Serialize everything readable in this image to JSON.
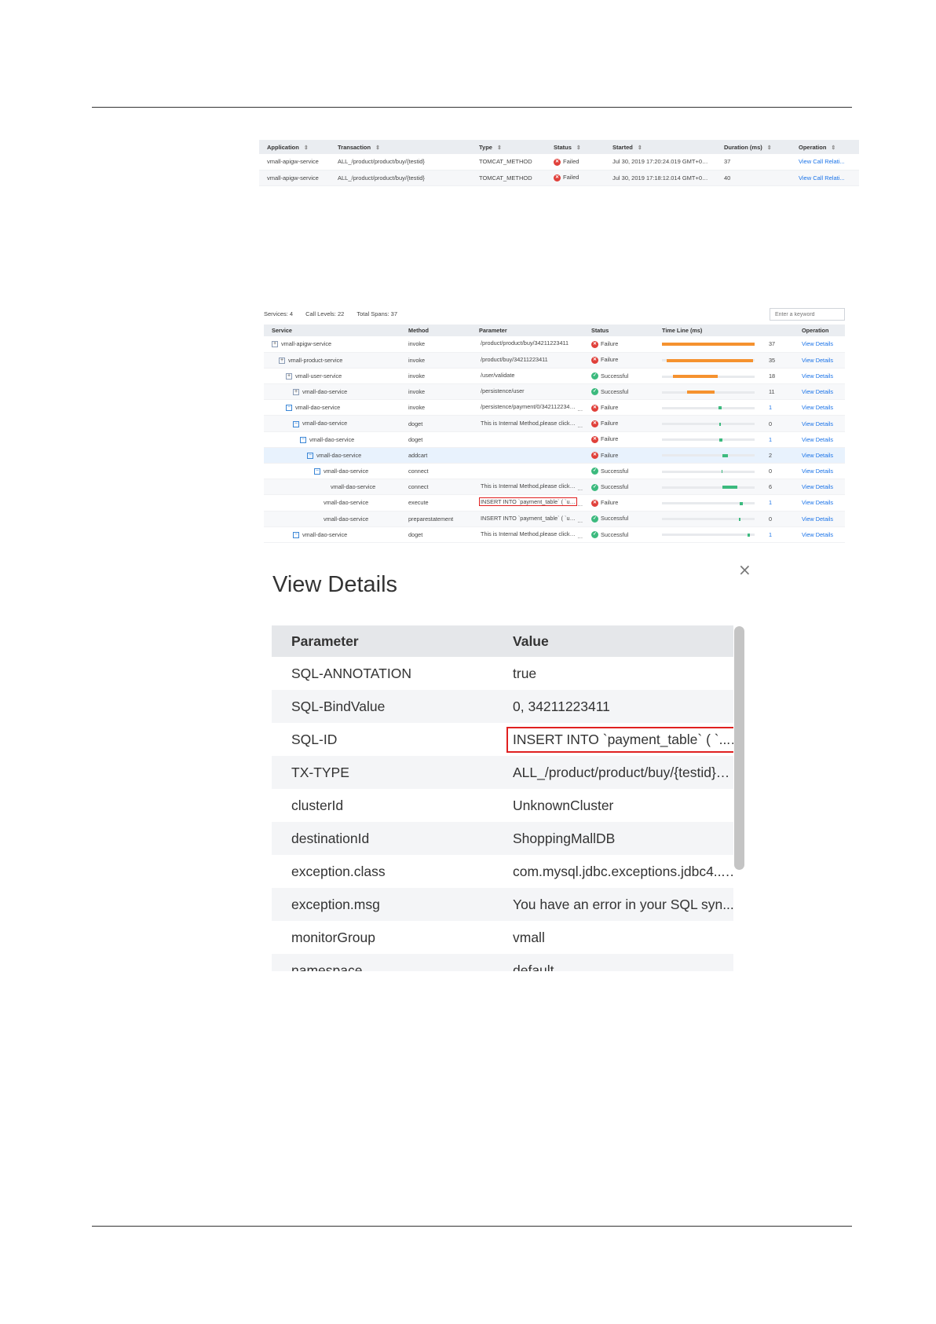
{
  "transactions": {
    "columns": [
      "Application",
      "Transaction",
      "Type",
      "Status",
      "Started",
      "Duration (ms)",
      "Operation"
    ],
    "rows": [
      {
        "application": "vmall-apigw-service",
        "transaction": "ALL_/product/product/buy/{testid}",
        "type": "TOMCAT_METHOD",
        "status": "Failed",
        "started": "Jul 30, 2019 17:20:24.019 GMT+08...",
        "duration": "37",
        "operation": "View Call Relati..."
      },
      {
        "application": "vmall-apigw-service",
        "transaction": "ALL_/product/product/buy/{testid}",
        "type": "TOMCAT_METHOD",
        "status": "Failed",
        "started": "Jul 30, 2019 17:18:12.014 GMT+08...",
        "duration": "40",
        "operation": "View Call Relati..."
      }
    ]
  },
  "trace": {
    "summary": {
      "services": "Services: 4",
      "call_levels": "Call Levels: 22",
      "total_spans": "Total Spans: 37"
    },
    "search_placeholder": "Enter a keyword",
    "columns": [
      "Service",
      "Method",
      "Parameter",
      "Status",
      "Time Line (ms)",
      "Operation"
    ],
    "colors": {
      "failure_bar": "#f5922f",
      "success_bar": "#3cba7e",
      "failure": "#e0403a",
      "success": "#3cba7e"
    },
    "rows": [
      {
        "service": "vmall-apigw-service",
        "indent": 0,
        "toggle": "plus",
        "method": "invoke",
        "parameter": "/product/product/buy/34211223411",
        "status": "Failure",
        "timeline": {
          "start": 0,
          "width": 1.0,
          "color": "orange"
        },
        "duration": "37",
        "operation": "View Details"
      },
      {
        "service": "vmall-product-service",
        "indent": 1,
        "toggle": "plus",
        "method": "invoke",
        "parameter": "/product/buy/34211223411",
        "status": "Failure",
        "timeline": {
          "start": 0.05,
          "width": 0.93,
          "color": "orange"
        },
        "duration": "35",
        "operation": "View Details"
      },
      {
        "service": "vmall-user-service",
        "indent": 2,
        "toggle": "plus",
        "method": "invoke",
        "parameter": "/user/validate",
        "status": "Successful",
        "timeline": {
          "start": 0.12,
          "width": 0.48,
          "color": "orange"
        },
        "duration": "18",
        "operation": "View Details"
      },
      {
        "service": "vmall-dao-service",
        "indent": 3,
        "toggle": "plus",
        "method": "invoke",
        "parameter": "/persistence/user",
        "status": "Successful",
        "timeline": {
          "start": 0.27,
          "width": 0.3,
          "color": "orange"
        },
        "duration": "11",
        "operation": "View Details"
      },
      {
        "service": "vmall-dao-service",
        "indent": 2,
        "toggle": "minus",
        "method": "invoke",
        "parameter": "/persistence/payment/0/3421122341...",
        "status": "Failure",
        "timeline": {
          "start": 0.61,
          "width": 0.03,
          "color": "green"
        },
        "duration": "1",
        "operation": "View Details"
      },
      {
        "service": "vmall-dao-service",
        "indent": 3,
        "toggle": "minus",
        "method": "doget",
        "parameter": "This is Internal Method,please click '...",
        "status": "Failure",
        "timeline": {
          "start": 0.62,
          "width": 0.01,
          "color": "green"
        },
        "duration": "0",
        "operation": "View Details"
      },
      {
        "service": "vmall-dao-service",
        "indent": 4,
        "toggle": "minus",
        "method": "doget",
        "parameter": "",
        "status": "Failure",
        "timeline": {
          "start": 0.62,
          "width": 0.03,
          "color": "green"
        },
        "duration": "1",
        "operation": "View Details"
      },
      {
        "service": "vmall-dao-service",
        "indent": 5,
        "toggle": "minus",
        "method": "addcart",
        "parameter": "",
        "status": "Failure",
        "timeline": {
          "start": 0.65,
          "width": 0.06,
          "color": "green"
        },
        "duration": "2",
        "operation": "View Details"
      },
      {
        "service": "vmall-dao-service",
        "indent": 6,
        "toggle": "minus",
        "method": "connect",
        "parameter": "",
        "status": "Successful",
        "timeline": {
          "start": 0.64,
          "width": 0.01,
          "color": "green"
        },
        "duration": "0",
        "operation": "View Details"
      },
      {
        "service": "vmall-dao-service",
        "indent": 7,
        "toggle": "",
        "method": "connect",
        "parameter": "This is Internal Method,please click '...",
        "status": "Successful",
        "timeline": {
          "start": 0.65,
          "width": 0.16,
          "color": "green"
        },
        "duration": "6",
        "operation": "View Details"
      },
      {
        "service": "vmall-dao-service",
        "indent": 6,
        "toggle": "",
        "method": "execute",
        "parameter": "INSERT INTO `payment_table` ( `us...",
        "status": "Failure",
        "timeline": {
          "start": 0.84,
          "width": 0.03,
          "color": "green"
        },
        "duration": "1",
        "operation": "View Details",
        "highlight": true
      },
      {
        "service": "vmall-dao-service",
        "indent": 6,
        "toggle": "",
        "method": "preparestatement",
        "parameter": "INSERT INTO `payment_table` ( `us...",
        "status": "Successful",
        "timeline": {
          "start": 0.83,
          "width": 0.01,
          "color": "green"
        },
        "duration": "0",
        "operation": "View Details"
      },
      {
        "service": "vmall-dao-service",
        "indent": 3,
        "toggle": "minus",
        "method": "doget",
        "parameter": "This is Internal Method,please click '...",
        "status": "Successful",
        "timeline": {
          "start": 0.92,
          "width": 0.03,
          "color": "green"
        },
        "duration": "1",
        "operation": "View Details"
      }
    ]
  },
  "details": {
    "title": "View Details",
    "close": "×",
    "columns": [
      "Parameter",
      "Value"
    ],
    "rows": [
      {
        "parameter": "SQL-ANNOTATION",
        "value": "true"
      },
      {
        "parameter": "SQL-BindValue",
        "value": "0, 34211223411"
      },
      {
        "parameter": "SQL-ID",
        "value": "INSERT INTO `payment_table` ( `...",
        "highlight": true
      },
      {
        "parameter": "TX-TYPE",
        "value": "ALL_/product/product/buy/{testid}"
      },
      {
        "parameter": "clusterId",
        "value": "UnknownCluster"
      },
      {
        "parameter": "destinationId",
        "value": "ShoppingMallDB"
      },
      {
        "parameter": "exception.class",
        "value": "com.mysql.jdbc.exceptions.jdbc4..."
      },
      {
        "parameter": "exception.msg",
        "value": "You have an error in your SQL syn..."
      },
      {
        "parameter": "monitorGroup",
        "value": "vmall"
      },
      {
        "parameter": "namespace",
        "value": "default"
      }
    ]
  }
}
